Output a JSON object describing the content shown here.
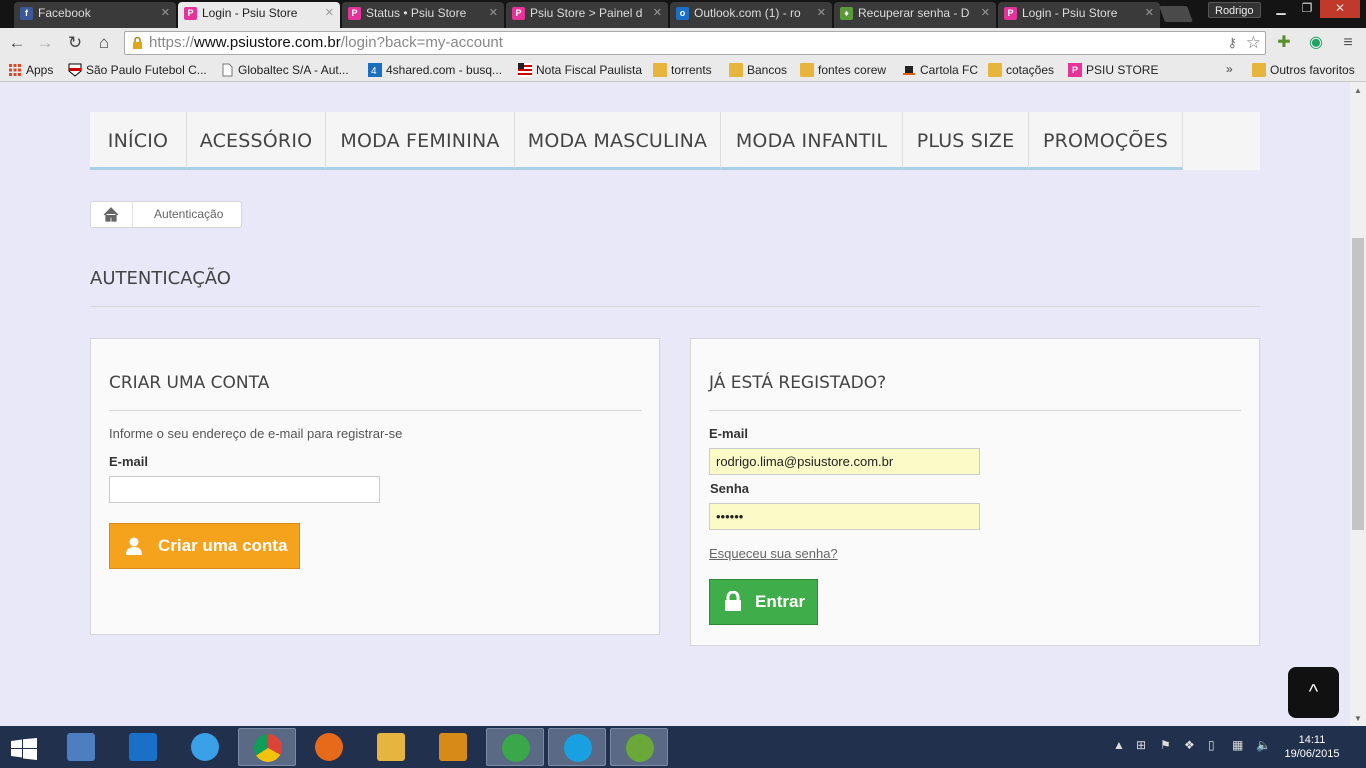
{
  "browser": {
    "tabs": [
      {
        "title": "Facebook",
        "favicon": "facebook-icon",
        "active": false
      },
      {
        "title": "Login - Psiu Store",
        "favicon": "psiu-icon",
        "active": true
      },
      {
        "title": "Status • Psiu Store",
        "favicon": "psiu-icon",
        "active": false
      },
      {
        "title": "Psiu Store > Painel d",
        "favicon": "psiu-icon",
        "active": false
      },
      {
        "title": "Outlook.com (1) - ro",
        "favicon": "outlook-icon",
        "active": false
      },
      {
        "title": "Recuperar senha - D",
        "favicon": "store-icon",
        "active": false
      },
      {
        "title": "Login - Psiu Store",
        "favicon": "psiu-icon",
        "active": false
      }
    ],
    "user": "Rodrigo",
    "url_scheme": "https://",
    "url_host": "www.psiustore.com.br",
    "url_path": "/login?back=my-account",
    "bookmarks": [
      {
        "label": "Apps",
        "icon": "apps-grid-icon"
      },
      {
        "label": "São Paulo Futebol C...",
        "icon": "spfc-icon"
      },
      {
        "label": "Globaltec S/A - Aut...",
        "icon": "page-icon"
      },
      {
        "label": "4shared.com - busq...",
        "icon": "4shared-icon"
      },
      {
        "label": "Nota Fiscal Paulista",
        "icon": "nfp-icon"
      },
      {
        "label": "torrents",
        "icon": "folder-icon"
      },
      {
        "label": "Bancos",
        "icon": "folder-icon"
      },
      {
        "label": "fontes corew",
        "icon": "folder-icon"
      },
      {
        "label": "Cartola FC",
        "icon": "cartola-icon"
      },
      {
        "label": "cotações",
        "icon": "folder-icon"
      },
      {
        "label": "PSIU STORE",
        "icon": "psiu-icon"
      }
    ],
    "bookmarks_more": "»",
    "other_bookmarks": "Outros favoritos"
  },
  "site": {
    "nav": [
      "INÍCIO",
      "ACESSÓRIO",
      "MODA FEMININA",
      "MODA MASCULINA",
      "MODA INFANTIL",
      "PLUS SIZE",
      "PROMOÇÕES"
    ],
    "breadcrumb": "Autenticação",
    "page_title": "AUTENTICAÇÃO",
    "create": {
      "title": "CRIAR UMA CONTA",
      "help": "Informe o seu endereço de e-mail para registrar-se",
      "email_label": "E-mail",
      "email_value": "",
      "button": "Criar uma conta"
    },
    "login": {
      "title": "JÁ ESTÁ REGISTADO?",
      "email_label": "E-mail",
      "email_value": "rodrigo.lima@psiustore.com.br",
      "password_label": "Senha",
      "password_value": "••••••",
      "forgot": "Esqueceu sua senha?",
      "button": "Entrar"
    },
    "back_to_top": "^"
  },
  "taskbar": {
    "time": "14:11",
    "date": "19/06/2015"
  },
  "colors": {
    "orange_button": "#f5a21c",
    "green_button": "#3fae4a",
    "nav_underline": "#a8d0e6",
    "page_bg": "#e8e8f8"
  }
}
